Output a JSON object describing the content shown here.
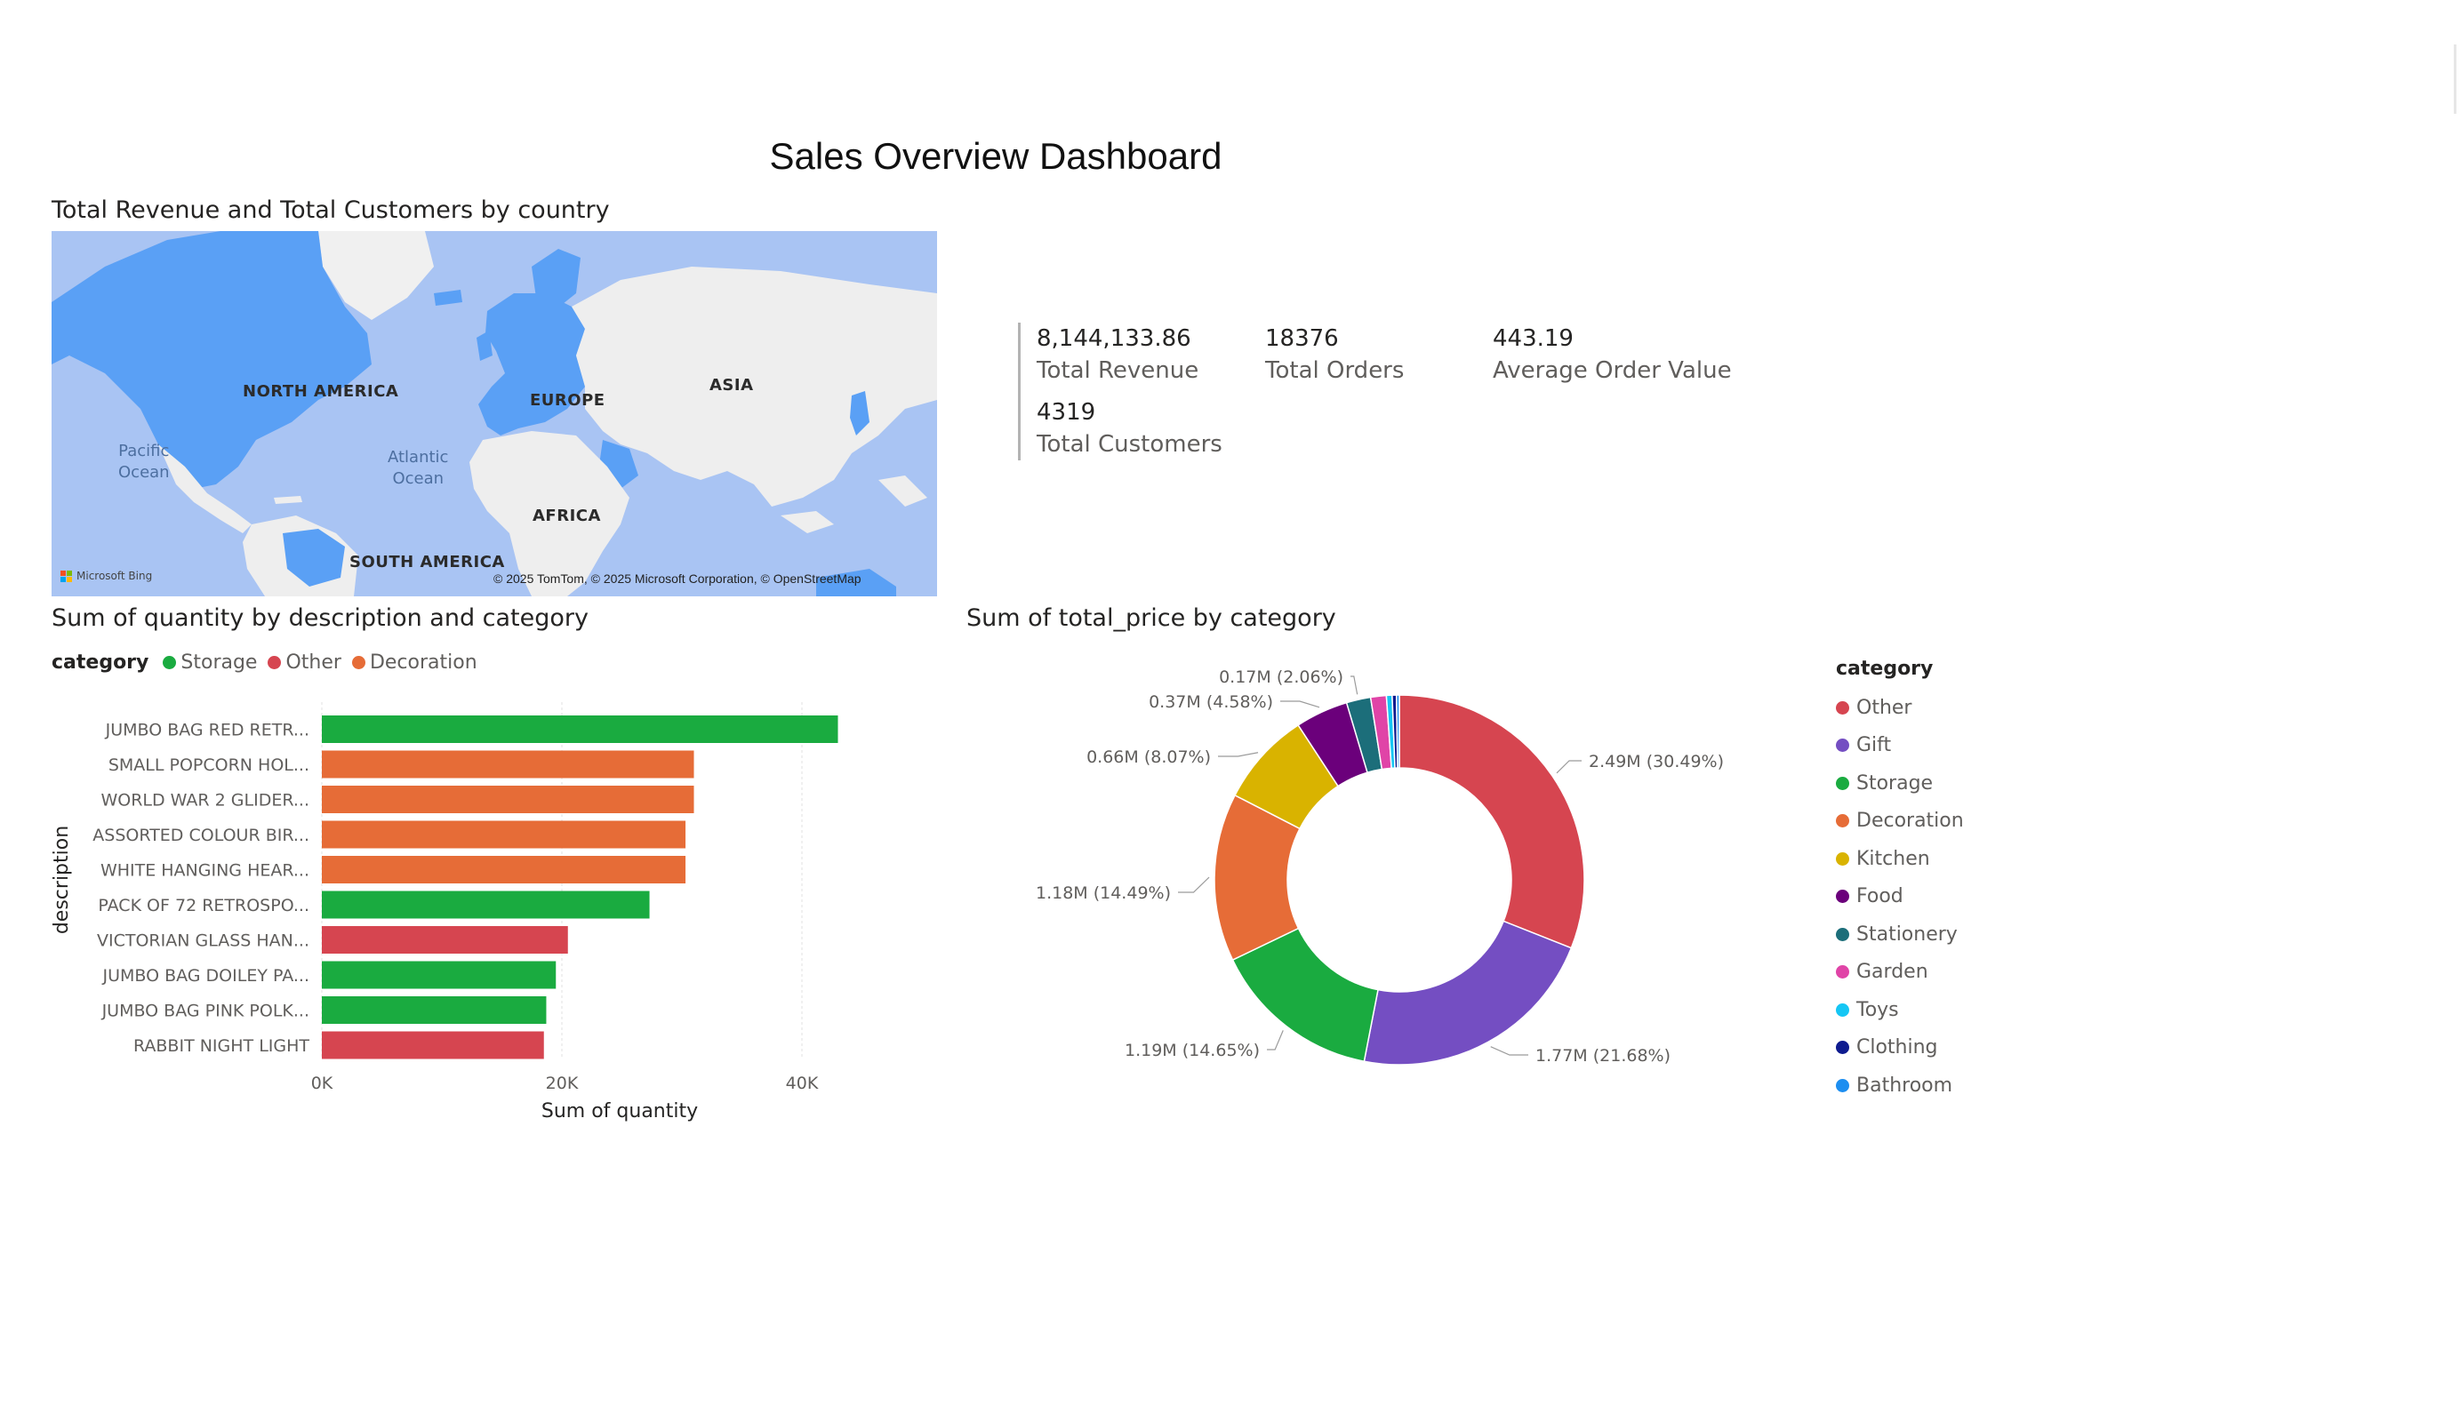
{
  "dashboard_title": "Sales Overview Dashboard",
  "map_visual": {
    "title": "Total Revenue and Total Customers by country",
    "continents": [
      "NORTH AMERICA",
      "EUROPE",
      "ASIA",
      "AFRICA",
      "SOUTH AMERICA"
    ],
    "oceans": [
      "Pacific\nOcean",
      "Atlantic\nOcean"
    ],
    "attribution_logo": "Microsoft Bing",
    "copyright": "© 2025 TomTom, © 2025 Microsoft Corporation, © OpenStreetMap"
  },
  "kpis": [
    {
      "value": "8,144,133.86",
      "label": "Total Revenue"
    },
    {
      "value": "18376",
      "label": "Total Orders"
    },
    {
      "value": "443.19",
      "label": "Average Order Value"
    },
    {
      "value": "4319",
      "label": "Total Customers"
    }
  ],
  "colors": {
    "Storage": "#1aab40",
    "Other": "#d64550",
    "Decoration": "#e66c37",
    "Gift": "#744ec2",
    "Kitchen": "#d9b300",
    "Food": "#6b007b",
    "Stationery": "#1c6e7a",
    "Garden": "#e044a7",
    "Toys": "#15c6f4",
    "Clothing": "#0e1b8f",
    "Bathroom": "#1d8ef0"
  },
  "chart_data": [
    {
      "type": "bar",
      "orientation": "horizontal",
      "title": "Sum of quantity by description and category",
      "xlabel": "Sum of quantity",
      "ylabel": "description",
      "xlim": [
        0,
        45000
      ],
      "xticks": [
        0,
        20000,
        40000
      ],
      "xtick_labels": [
        "0K",
        "20K",
        "40K"
      ],
      "legend_title": "category",
      "legend": [
        "Storage",
        "Other",
        "Decoration"
      ],
      "legend_placement": "top-left",
      "categories": [
        "JUMBO BAG RED RETR...",
        "SMALL POPCORN HOL...",
        "WORLD WAR 2 GLIDER...",
        "ASSORTED COLOUR BIR...",
        "WHITE HANGING HEAR...",
        "PACK OF 72 RETROSPO...",
        "VICTORIAN GLASS HAN...",
        "JUMBO BAG DOILEY PA...",
        "JUMBO BAG PINK POLK...",
        "RABBIT NIGHT LIGHT"
      ],
      "values": [
        43000,
        31000,
        31000,
        30300,
        30300,
        27300,
        20500,
        19500,
        18700,
        18500
      ],
      "bar_category": [
        "Storage",
        "Decoration",
        "Decoration",
        "Decoration",
        "Decoration",
        "Storage",
        "Other",
        "Storage",
        "Storage",
        "Other"
      ],
      "grid": true
    },
    {
      "type": "pie",
      "variant": "donut",
      "title": "Sum of total_price by category",
      "legend_title": "category",
      "legend_placement": "right",
      "categories": [
        "Other",
        "Gift",
        "Storage",
        "Decoration",
        "Kitchen",
        "Food",
        "Stationery",
        "Garden",
        "Toys",
        "Clothing",
        "Bathroom"
      ],
      "values": [
        2490000,
        1770000,
        1190000,
        1180000,
        660000,
        370000,
        170000,
        110000,
        40000,
        30000,
        20000
      ],
      "percents": [
        30.49,
        21.68,
        14.65,
        14.49,
        8.07,
        4.58,
        2.06,
        1.35,
        0.35,
        0.2,
        0.08
      ],
      "data_labels": [
        "2.49M (30.49%)",
        "1.77M (21.68%)",
        "1.19M (14.65%)",
        "1.18M (14.49%)",
        "0.66M (8.07%)",
        "0.37M (4.58%)",
        "0.17M (2.06%)",
        "",
        "",
        "",
        ""
      ]
    }
  ]
}
